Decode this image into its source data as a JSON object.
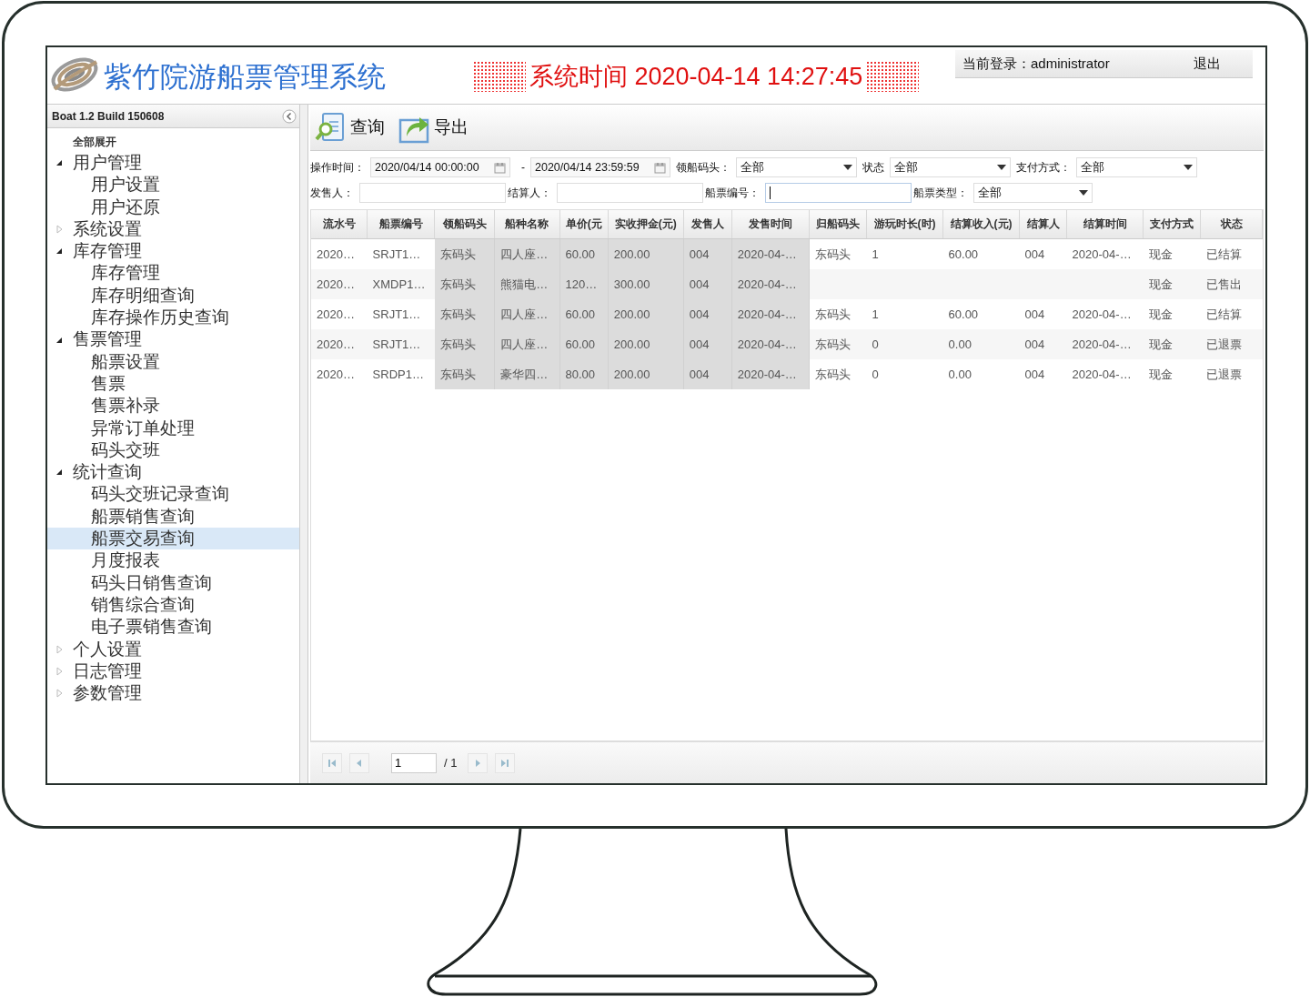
{
  "header": {
    "title": "紫竹院游船票管理系统",
    "clock": "系统时间 2020-04-14 14:27:45",
    "login": "当前登录：administrator",
    "logout": "退出"
  },
  "sidebar": {
    "version": "Boat 1.2 Build 150608",
    "expand_all": "全部展开",
    "tree": [
      {
        "label": "用户管理",
        "expanded": true,
        "selected": false,
        "children": [
          {
            "label": "用户设置",
            "selected": false
          },
          {
            "label": "用户还原",
            "selected": false
          }
        ]
      },
      {
        "label": "系统设置",
        "expanded": false,
        "selected": false
      },
      {
        "label": "库存管理",
        "expanded": true,
        "selected": false,
        "children": [
          {
            "label": "库存管理",
            "selected": false
          },
          {
            "label": "库存明细查询",
            "selected": false
          },
          {
            "label": "库存操作历史查询",
            "selected": false
          }
        ]
      },
      {
        "label": "售票管理",
        "expanded": true,
        "selected": false,
        "children": [
          {
            "label": "船票设置",
            "selected": false
          },
          {
            "label": "售票",
            "selected": false
          },
          {
            "label": "售票补录",
            "selected": false
          },
          {
            "label": "异常订单处理",
            "selected": false
          },
          {
            "label": "码头交班",
            "selected": false
          }
        ]
      },
      {
        "label": "统计查询",
        "expanded": true,
        "selected": false,
        "children": [
          {
            "label": "码头交班记录查询",
            "selected": false
          },
          {
            "label": "船票销售查询",
            "selected": false
          },
          {
            "label": "船票交易查询",
            "selected": true
          },
          {
            "label": "月度报表",
            "selected": false
          },
          {
            "label": "码头日销售查询",
            "selected": false
          },
          {
            "label": "销售综合查询",
            "selected": false
          },
          {
            "label": "电子票销售查询",
            "selected": false
          }
        ]
      },
      {
        "label": "个人设置",
        "expanded": false,
        "selected": false
      },
      {
        "label": "日志管理",
        "expanded": false,
        "selected": false
      },
      {
        "label": "参数管理",
        "expanded": false,
        "selected": false
      }
    ]
  },
  "toolbar": [
    {
      "label": "查询",
      "kind": "search"
    },
    {
      "label": "导出",
      "kind": "export"
    }
  ],
  "filters": [
    [
      {
        "kind": "label",
        "label": "操作时间："
      },
      {
        "kind": "date",
        "value": "2020/04/14 00:00:00"
      },
      {
        "kind": "sep",
        "label": "-"
      },
      {
        "kind": "date",
        "value": "2020/04/14 23:59:59"
      },
      {
        "kind": "label",
        "label": "领船码头："
      },
      {
        "kind": "select",
        "value": "全部"
      },
      {
        "kind": "label",
        "label": "状态"
      },
      {
        "kind": "select",
        "value": "全部"
      },
      {
        "kind": "label",
        "label": "支付方式："
      },
      {
        "kind": "select",
        "value": "全部"
      }
    ],
    [
      {
        "kind": "label",
        "label": "发售人："
      },
      {
        "kind": "text",
        "focused": false
      },
      {
        "kind": "label",
        "label": "结算人："
      },
      {
        "kind": "text",
        "focused": false
      },
      {
        "kind": "label",
        "label": "船票编号："
      },
      {
        "kind": "text",
        "focused": true
      },
      {
        "kind": "label",
        "label": "船票类型："
      },
      {
        "kind": "select",
        "value": "全部"
      }
    ]
  ],
  "table": {
    "columns": [
      {
        "label": "流水号",
        "shaded": false
      },
      {
        "label": "船票编号",
        "shaded": false
      },
      {
        "label": "领船码头",
        "shaded": true
      },
      {
        "label": "船种名称",
        "shaded": true
      },
      {
        "label": "单价(元",
        "shaded": true
      },
      {
        "label": "实收押金(元)",
        "shaded": true
      },
      {
        "label": "发售人",
        "shaded": true
      },
      {
        "label": "发售时间",
        "shaded": true
      },
      {
        "label": "归船码头",
        "shaded": false
      },
      {
        "label": "游玩时长(时)",
        "shaded": false
      },
      {
        "label": "结算收入(元)",
        "shaded": false
      },
      {
        "label": "结算人",
        "shaded": false
      },
      {
        "label": "结算时间",
        "shaded": false
      },
      {
        "label": "支付方式",
        "shaded": false
      },
      {
        "label": "状态",
        "shaded": false
      }
    ],
    "rows": [
      [
        "2020…",
        "SRJT1…",
        "东码头",
        "四人座…",
        "60.00",
        "200.00",
        "004",
        "2020-04-…",
        "东码头",
        "1",
        "60.00",
        "004",
        "2020-04-…",
        "现金",
        "已结算"
      ],
      [
        "2020…",
        "XMDP1…",
        "东码头",
        "熊猫电…",
        "120…",
        "300.00",
        "004",
        "2020-04-…",
        null,
        null,
        null,
        null,
        null,
        "现金",
        "已售出"
      ],
      [
        "2020…",
        "SRJT1…",
        "东码头",
        "四人座…",
        "60.00",
        "200.00",
        "004",
        "2020-04-…",
        "东码头",
        "1",
        "60.00",
        "004",
        "2020-04-…",
        "现金",
        "已结算"
      ],
      [
        "2020…",
        "SRJT1…",
        "东码头",
        "四人座…",
        "60.00",
        "200.00",
        "004",
        "2020-04-…",
        "东码头",
        "0",
        "0.00",
        "004",
        "2020-04-…",
        "现金",
        "已退票"
      ],
      [
        "2020…",
        "SRDP1…",
        "东码头",
        "豪华四…",
        "80.00",
        "200.00",
        "004",
        "2020-04-…",
        "东码头",
        "0",
        "0.00",
        "004",
        "2020-04-…",
        "现金",
        "已退票"
      ]
    ]
  },
  "pager": {
    "page": "1",
    "total": "/ 1"
  }
}
